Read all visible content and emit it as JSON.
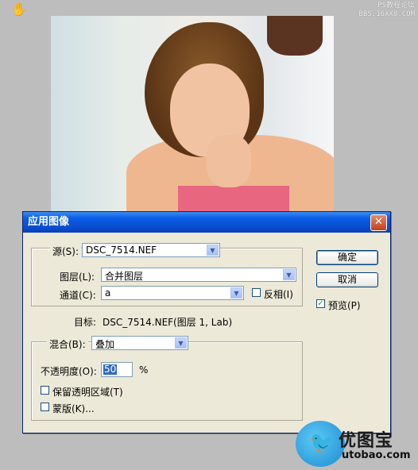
{
  "watermark": {
    "line1": "PS教程论坛",
    "line2": "BBS.16XX8.COM"
  },
  "dialog": {
    "title": "应用图像",
    "source": {
      "label": "源(S):",
      "value": "DSC_7514.NEF"
    },
    "layer": {
      "label": "图层(L):",
      "value": "合并图层"
    },
    "channel": {
      "label": "通道(C):",
      "value": "a"
    },
    "invert": {
      "label": "反相(I)",
      "checked": false
    },
    "target": {
      "label": "目标:",
      "value": "DSC_7514.NEF(图层 1, Lab)"
    },
    "blending": {
      "label": "混合(B):",
      "value": "叠加"
    },
    "opacity": {
      "label": "不透明度(O):",
      "value": "50",
      "unit": "%"
    },
    "preserve_transparency": {
      "label": "保留透明区域(T)",
      "checked": false
    },
    "mask": {
      "label": "蒙版(K)...",
      "checked": false
    },
    "ok_label": "确定",
    "cancel_label": "取消",
    "preview": {
      "label": "预览(P)",
      "checked": true
    }
  },
  "brand": {
    "name": "优图宝",
    "url": "utobao.com"
  },
  "colors": {
    "titlebar": "#0a4fd0",
    "dialog_bg": "#ece9d8",
    "selection": "#316ac5"
  },
  "icons": [
    "hand-tool-icon",
    "close-icon",
    "chevron-down-icon",
    "checkmark-icon",
    "bird-logo-icon"
  ]
}
